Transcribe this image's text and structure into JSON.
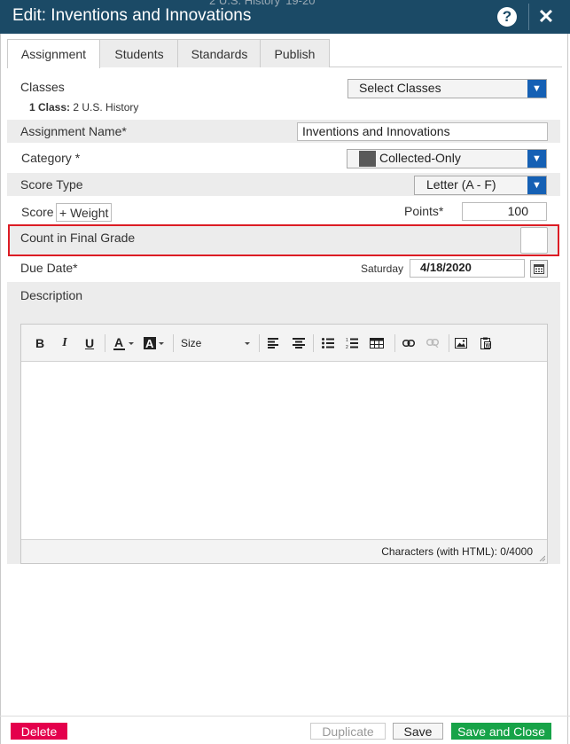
{
  "window": {
    "ghost_text": "2 U.S. History",
    "ghost_text2": "19-20",
    "title": "Edit: Inventions and Innovations",
    "help_glyph": "?",
    "close_glyph": "✕"
  },
  "tabs": [
    {
      "label": "Assignment",
      "active": true
    },
    {
      "label": "Students",
      "active": false
    },
    {
      "label": "Standards",
      "active": false
    },
    {
      "label": "Publish",
      "active": false
    }
  ],
  "form": {
    "classes_label": "Classes",
    "classes_select": "Select Classes",
    "classes_count": "1 Class:",
    "classes_value": "2 U.S. History",
    "assignment_name_label": "Assignment Name*",
    "assignment_name_value": "Inventions and Innovations",
    "category_label": "Category *",
    "category_value": "Collected-Only",
    "category_color": "#595959",
    "score_type_label": "Score Type",
    "score_type_value": "Letter (A - F)",
    "score_label": "Score",
    "weight_button": "+ Weight",
    "points_label": "Points*",
    "points_value": "100",
    "count_final_label": "Count in Final Grade",
    "count_final_checked": false,
    "due_date_label": "Due Date*",
    "due_day": "Saturday",
    "due_date_value": "4/18/2020",
    "description_label": "Description"
  },
  "editor": {
    "size_label": "Size",
    "char_count": "Characters (with HTML): 0/4000"
  },
  "buttons": {
    "delete": "Delete",
    "duplicate": "Duplicate",
    "save": "Save",
    "save_close": "Save and Close"
  },
  "colors": {
    "titlebar": "#1b4a66",
    "select_arrow": "#1560b4",
    "highlight": "#dc1c24",
    "delete": "#e4004c",
    "save_close": "#17a348"
  }
}
